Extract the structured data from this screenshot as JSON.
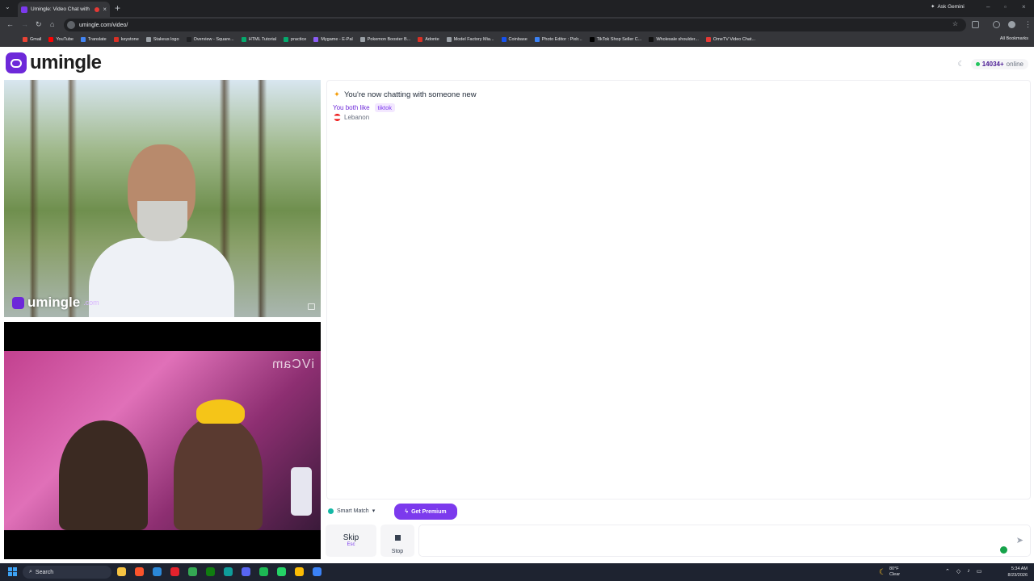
{
  "browser": {
    "tab_title": "Umingle: Video Chat with S",
    "url": "umingle.com/video/",
    "ask_gemini": "Ask Gemini",
    "all_bookmarks": "All Bookmarks",
    "bookmarks": [
      {
        "label": "Gmail",
        "color": "#ea4335"
      },
      {
        "label": "YouTube",
        "color": "#ff0000"
      },
      {
        "label": "Translate",
        "color": "#4285f4"
      },
      {
        "label": "keystone",
        "color": "#d93025"
      },
      {
        "label": "Stakeus logo",
        "color": "#9aa0a6"
      },
      {
        "label": "Overview - Square...",
        "color": "#202124"
      },
      {
        "label": "HTML Tutorial",
        "color": "#04aa6d"
      },
      {
        "label": "practice",
        "color": "#04aa6d"
      },
      {
        "label": "Mygame - E-Pal",
        "color": "#8b5cf6"
      },
      {
        "label": "Pokemon Booster B...",
        "color": "#9aa0a6"
      },
      {
        "label": "Adonte",
        "color": "#d93025"
      },
      {
        "label": "Model Factory Mia...",
        "color": "#9aa0a6"
      },
      {
        "label": "Coinbase",
        "color": "#1652f0"
      },
      {
        "label": "Photo Editor : Pixlr...",
        "color": "#3b82f6"
      },
      {
        "label": "TikTok Shop Seller C...",
        "color": "#000000"
      },
      {
        "label": "Wholesale shoulder...",
        "color": "#111111"
      },
      {
        "label": "OmeTV Video Chat...",
        "color": "#e53935"
      }
    ]
  },
  "site": {
    "logo_text": "umingle",
    "online_count": "14034+",
    "online_label": "online",
    "accent": "#6d28d9"
  },
  "remote_video": {
    "watermark": "umingle",
    "watermark_suffix": ".com"
  },
  "local_video": {
    "overlay_text": "iVCam"
  },
  "chat": {
    "new_chat_message": "You're now chatting with someone new",
    "both_like_label": "You both like",
    "interest_tag": "tiktok",
    "country": "Lebanon"
  },
  "controls": {
    "smart_match_label": "Smart Match",
    "premium_label": "Get Premium",
    "skip_label": "Skip",
    "skip_key": "Esc",
    "stop_label": "Stop"
  },
  "taskbar": {
    "search_label": "Search",
    "weather_temp": "80°F",
    "weather_desc": "Clear",
    "time": "5:34 AM",
    "date": "8/23/2026",
    "apps": [
      {
        "name": "explorer",
        "color": "#f6c342"
      },
      {
        "name": "brave",
        "color": "#fb542b"
      },
      {
        "name": "store",
        "color": "#2b88d8"
      },
      {
        "name": "opera",
        "color": "#e4222d"
      },
      {
        "name": "chrome",
        "color": "#34a853"
      },
      {
        "name": "xbox",
        "color": "#107c10"
      },
      {
        "name": "edge",
        "color": "#0f9d9a"
      },
      {
        "name": "discord",
        "color": "#5865f2"
      },
      {
        "name": "spotify",
        "color": "#1db954"
      },
      {
        "name": "whatsapp",
        "color": "#25d366"
      },
      {
        "name": "chrome-active",
        "color": "#fbbc05"
      },
      {
        "name": "umingle-app",
        "color": "#3b82f6"
      }
    ]
  }
}
